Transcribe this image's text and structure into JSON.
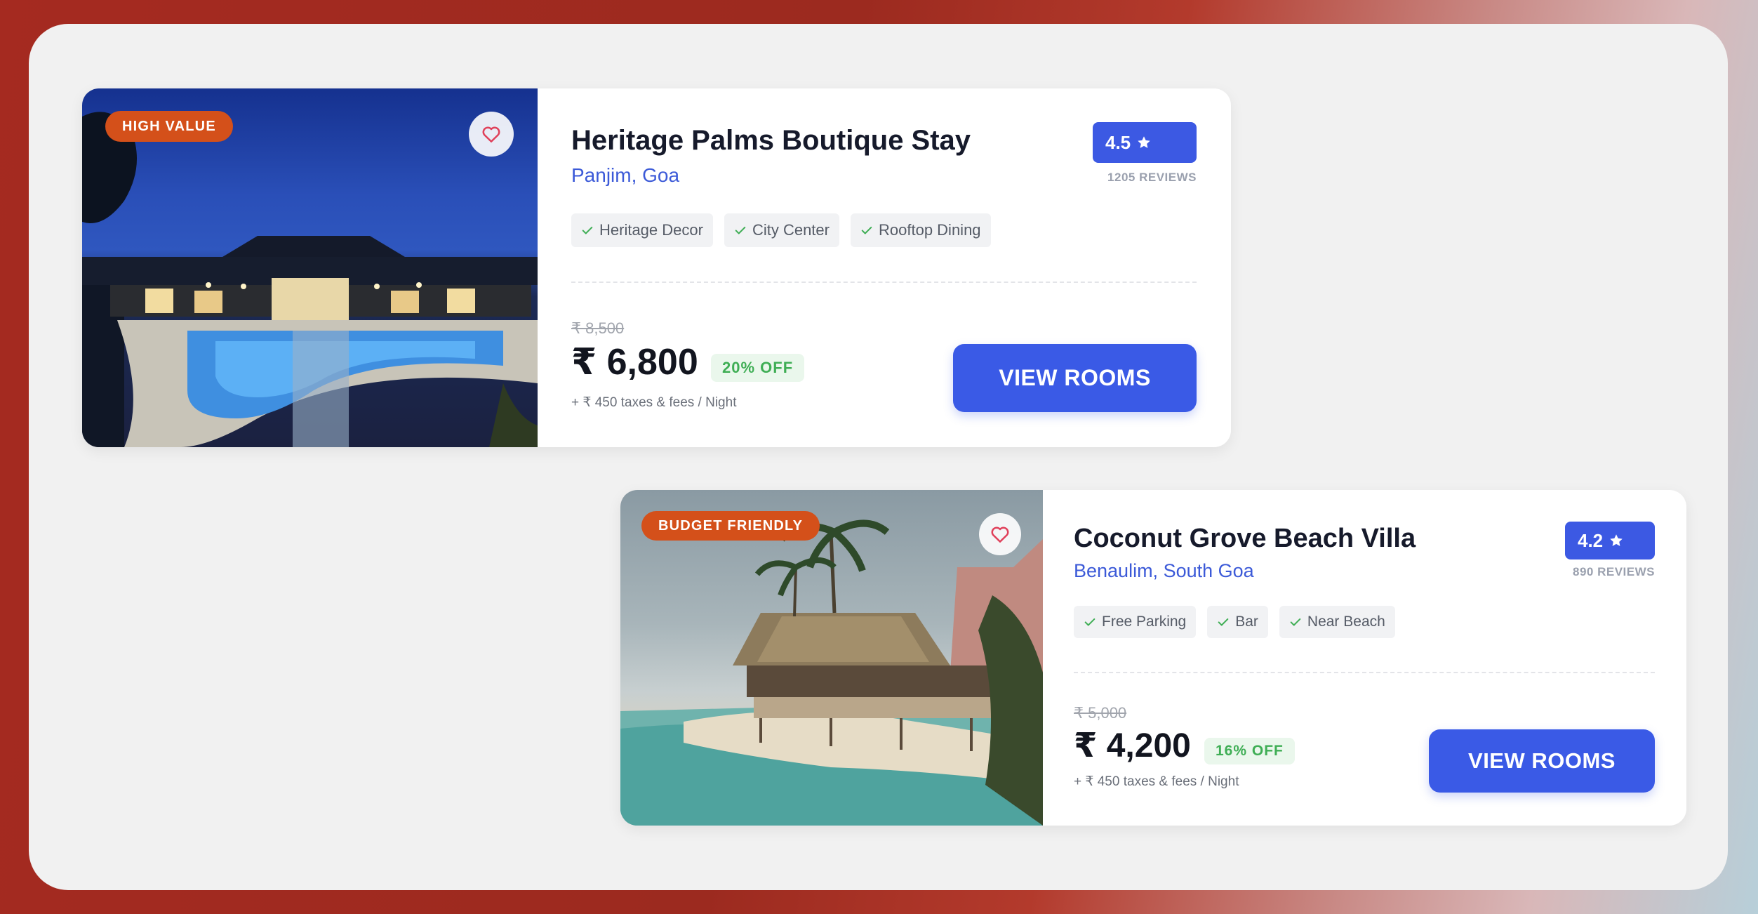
{
  "listings": [
    {
      "badge": "HIGH VALUE",
      "favorite_icon": "heart-icon",
      "name": "Heritage Palms Boutique Stay",
      "location": "Panjim, Goa",
      "rating": "4.5",
      "rating_icon": "star-icon",
      "reviews": "1205 REVIEWS",
      "amenities": [
        "Heritage Decor",
        "City Center",
        "Rooftop Dining"
      ],
      "original_price": "₹ 8,500",
      "price": "₹ 6,800",
      "discount": "20% OFF",
      "taxes": "+ ₹ 450 taxes & fees / Night",
      "cta": "VIEW ROOMS"
    },
    {
      "badge": "BUDGET FRIENDLY",
      "favorite_icon": "heart-icon",
      "name": "Coconut Grove Beach Villa",
      "location": "Benaulim, South Goa",
      "rating": "4.2",
      "rating_icon": "star-icon",
      "reviews": "890 REVIEWS",
      "amenities": [
        "Free Parking",
        "Bar",
        "Near Beach"
      ],
      "original_price": "₹ 5,000",
      "price": "₹ 4,200",
      "discount": "16% OFF",
      "taxes": "+ ₹ 450 taxes & fees / Night",
      "cta": "VIEW ROOMS"
    }
  ],
  "colors": {
    "accent": "#3a5ae6",
    "badge": "#d4501a",
    "discount_text": "#3fae55",
    "location_text": "#3c5ad8",
    "heart": "#e0405a"
  }
}
